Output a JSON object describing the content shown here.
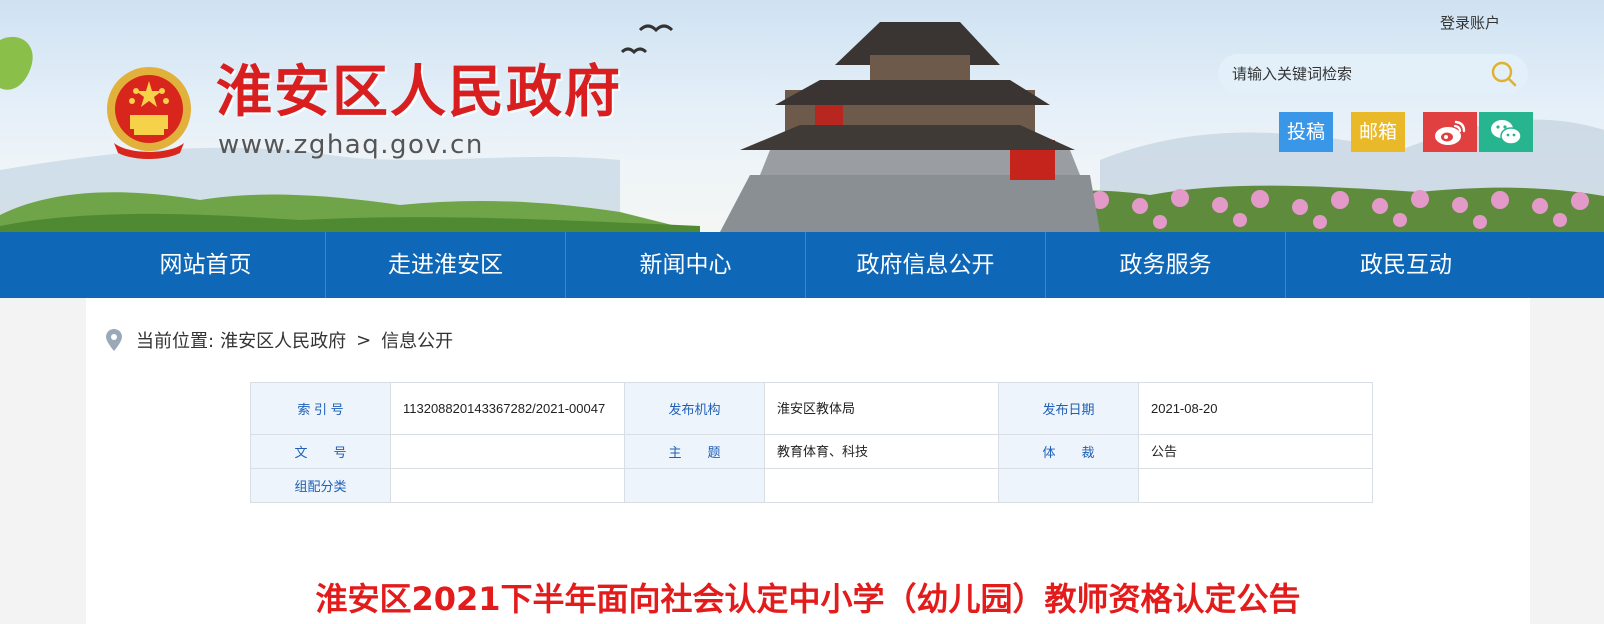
{
  "header": {
    "site_title": "淮安区人民政府",
    "site_url": "www.zghaq.gov.cn",
    "login_label": "登录账户",
    "search": {
      "placeholder": "请输入关键词检索"
    },
    "buttons": {
      "tougao": "投稿",
      "youxiang": "邮箱"
    }
  },
  "nav": {
    "items": [
      "网站首页",
      "走进淮安区",
      "新闻中心",
      "政府信息公开",
      "政务服务",
      "政民互动"
    ]
  },
  "breadcrumb": {
    "prefix": "当前位置:",
    "items": [
      "淮安区人民政府",
      "信息公开"
    ],
    "separator": ">"
  },
  "info_table": {
    "index_label": "索 引 号",
    "index_value": "113208820143367282/2021-00047",
    "org_label": "发布机构",
    "org_value": "淮安区教体局",
    "date_label": "发布日期",
    "date_value": "2021-08-20",
    "docno_label": "文　　号",
    "docno_value": "",
    "topic_label": "主　　题",
    "topic_value": "教育体育、科技",
    "genre_label": "体　　裁",
    "genre_value": "公告",
    "category_label": "组配分类",
    "category_value": ""
  },
  "article": {
    "title": "淮安区2021下半年面向社会认定中小学（幼儿园）教师资格认定公告"
  },
  "colors": {
    "nav_bg": "#0f67b8",
    "title_red": "#e41b1b",
    "label_blue": "#1f5fb6",
    "tougao": "#3a97e8",
    "youxiang": "#e9b92a",
    "weibo": "#e04040",
    "wechat": "#27b58f"
  },
  "icons": {
    "search": "search-icon",
    "location": "location-pin-icon",
    "weibo": "weibo-icon",
    "wechat": "wechat-icon"
  }
}
